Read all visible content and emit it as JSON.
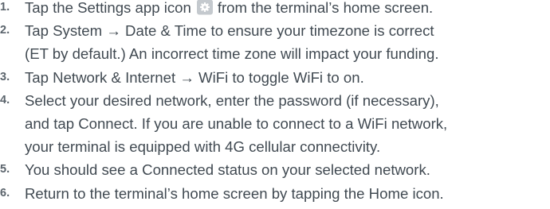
{
  "steps": [
    {
      "number": "1.",
      "before_icon": "Tap the Settings app icon",
      "icon": "settings-gear-icon",
      "after_icon": "from the terminal’s home screen."
    },
    {
      "number": "2.",
      "lines": [
        "Tap System → Date & Time to ensure your timezone is correct",
        "(ET by default.) An incorrect time zone will impact your funding."
      ]
    },
    {
      "number": "3.",
      "lines": [
        "Tap Network & Internet → WiFi to toggle WiFi to on."
      ]
    },
    {
      "number": "4.",
      "lines": [
        "Select your desired network, enter the password (if necessary),",
        "and tap Connect. If you are unable to connect to a WiFi network,",
        "your terminal is equipped with 4G cellular connectivity."
      ]
    },
    {
      "number": "5.",
      "lines": [
        "You should see a Connected status on your selected network."
      ]
    },
    {
      "number": "6.",
      "lines": [
        "Return to the terminal’s home screen by tapping the Home icon."
      ]
    }
  ]
}
